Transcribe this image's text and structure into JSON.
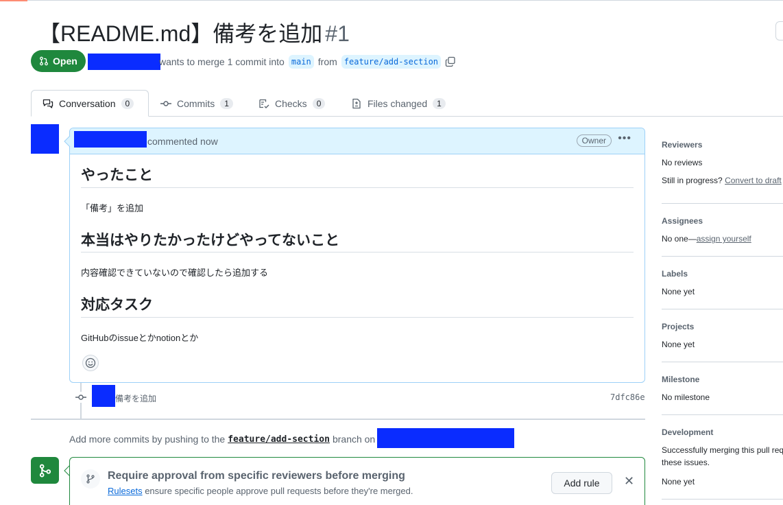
{
  "pr": {
    "title": "【README.md】備考を追加",
    "number": "#1",
    "state": "Open",
    "meta_text": "wants to merge 1 commit into",
    "base_branch": "main",
    "from_text": "from",
    "head_branch": "feature/add-section"
  },
  "tabs": [
    {
      "label": "Conversation",
      "count": "0"
    },
    {
      "label": "Commits",
      "count": "1"
    },
    {
      "label": "Checks",
      "count": "0"
    },
    {
      "label": "Files changed",
      "count": "1"
    }
  ],
  "comment": {
    "header_text": "commented now",
    "role_badge": "Owner",
    "sections": [
      {
        "heading": "やったこと",
        "text": "「備考」を追加"
      },
      {
        "heading": "本当はやりたかったけどやってないこと",
        "text": "内容確認できていないので確認したら追加する"
      },
      {
        "heading": "対応タスク",
        "text": "GitHubのissueとかnotionとか"
      }
    ]
  },
  "commit": {
    "message": "備考を追加",
    "sha": "7dfc86e"
  },
  "push_hint": {
    "prefix": "Add more commits by pushing to the",
    "branch": "feature/add-section",
    "suffix": "branch on"
  },
  "merge_box": {
    "title": "Require approval from specific reviewers before merging",
    "link": "Rulesets",
    "description": "ensure specific people approve pull requests before they're merged.",
    "button": "Add rule"
  },
  "sidebar": {
    "reviewers": {
      "heading": "Reviewers",
      "value": "No reviews",
      "progress_prefix": "Still in progress?",
      "progress_link": "Convert to draft"
    },
    "assignees": {
      "heading": "Assignees",
      "value_prefix": "No one—",
      "value_link": "assign yourself"
    },
    "labels": {
      "heading": "Labels",
      "value": "None yet"
    },
    "projects": {
      "heading": "Projects",
      "value": "None yet"
    },
    "milestone": {
      "heading": "Milestone",
      "value": "No milestone"
    },
    "development": {
      "heading": "Development",
      "line1": "Successfully merging this pull request may close",
      "line2": "these issues.",
      "value": "None yet"
    }
  },
  "colors": {
    "open_green": "#1f883d",
    "redaction": "#0a2cff",
    "link_blue": "#0969da"
  }
}
